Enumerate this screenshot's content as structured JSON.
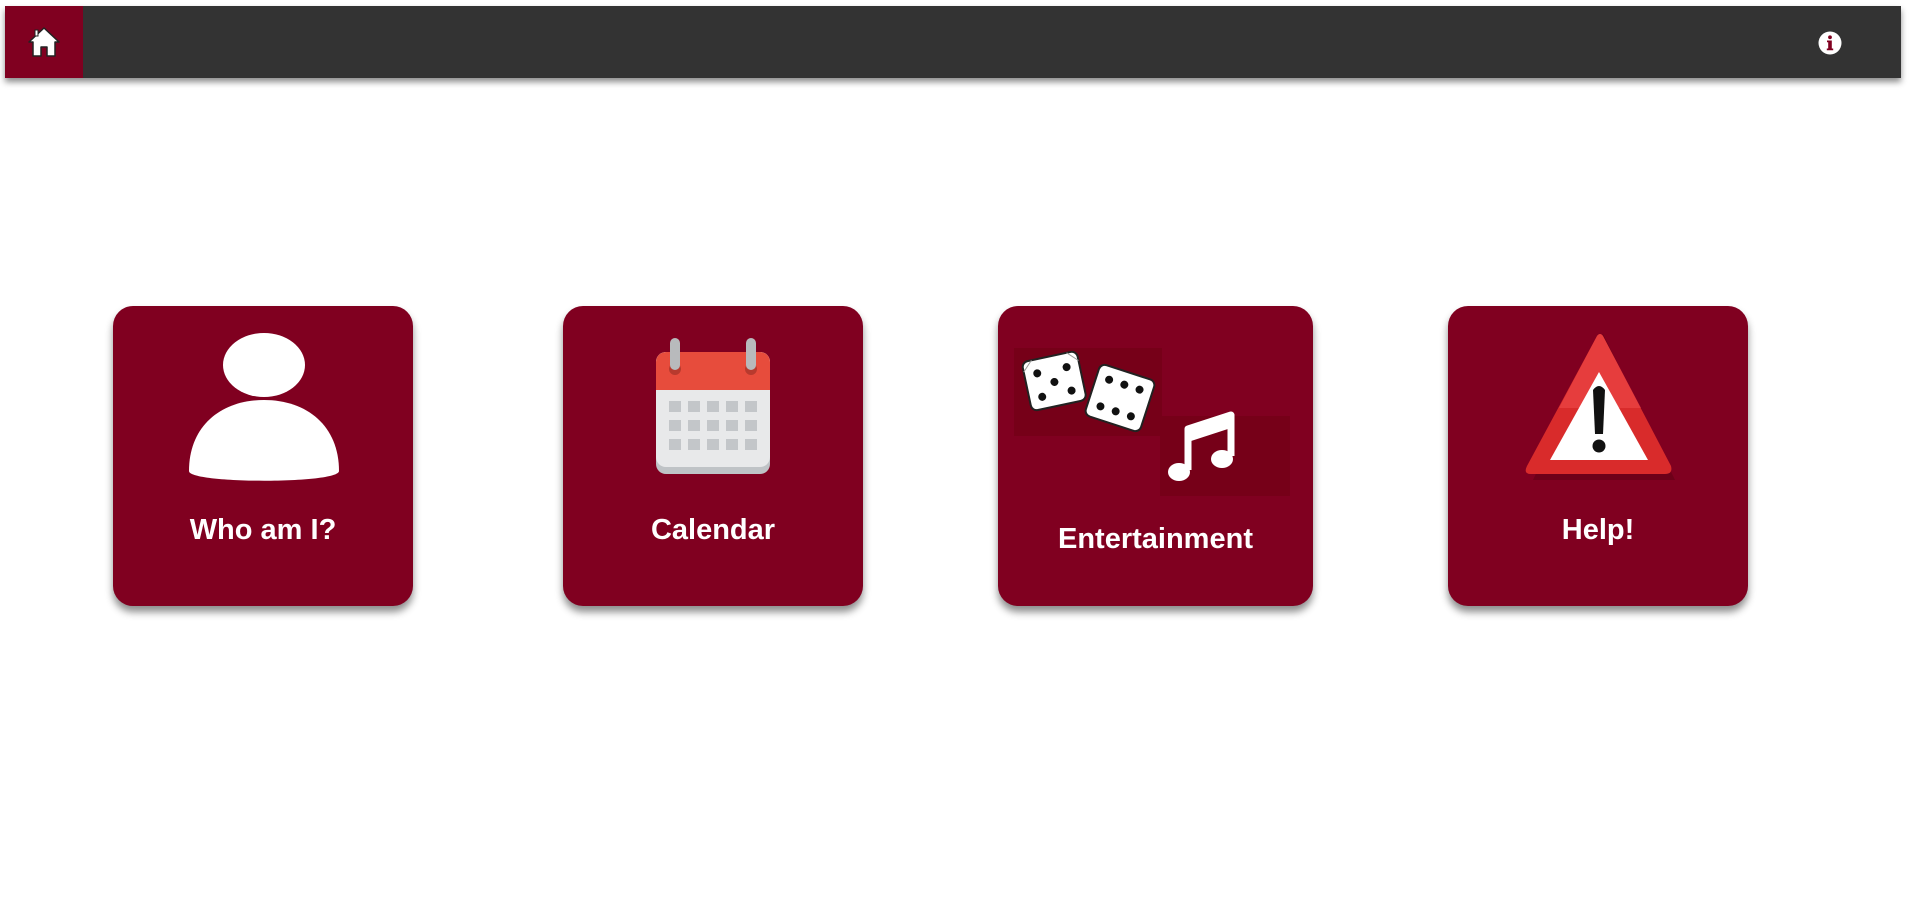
{
  "header": {
    "home_icon": "home-icon",
    "info_icon": "info-icon",
    "background_color": "#333333",
    "accent_color": "#800020"
  },
  "tiles": [
    {
      "label": "Who am I?",
      "icon": "person-icon"
    },
    {
      "label": "Calendar",
      "icon": "calendar-icon"
    },
    {
      "label": "Entertainment",
      "icon": "dice-and-music-icon"
    },
    {
      "label": "Help!",
      "icon": "warning-icon"
    }
  ]
}
